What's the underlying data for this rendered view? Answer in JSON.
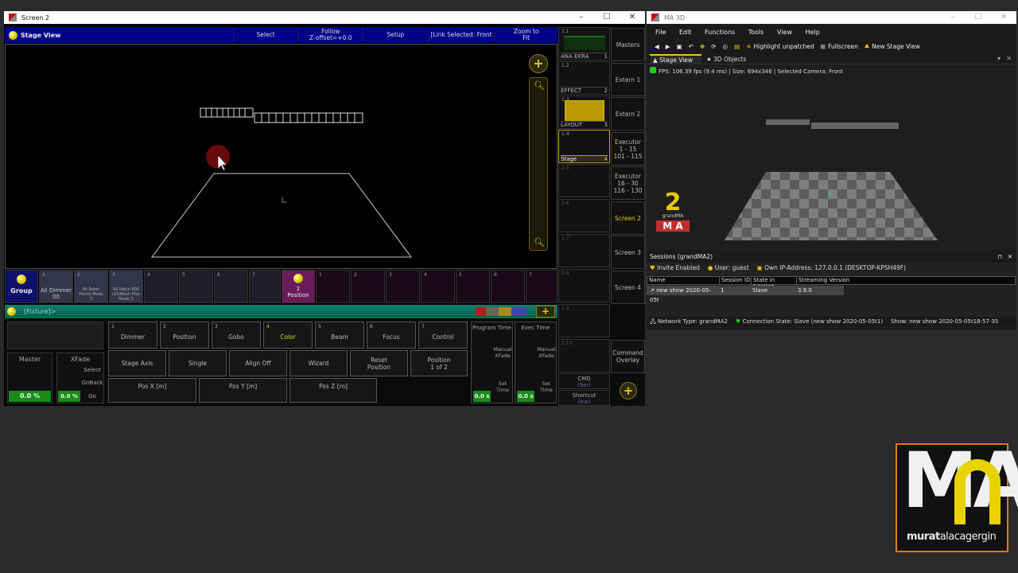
{
  "screen2": {
    "title": "Screen 2",
    "view_title": "Stage View",
    "header_buttons": [
      "Select",
      "Follow\nZ-offset=+0.0",
      "Setup",
      "[Link Selected: Front",
      "Zoom to\nFit"
    ]
  },
  "executors": [
    {
      "num": "1.1",
      "label": "ANA EKRA",
      "page": "1"
    },
    {
      "num": "1.2",
      "label": "EFFECT",
      "page": "2"
    },
    {
      "num": "1.3",
      "label": "LAYOUT",
      "page": "3"
    },
    {
      "num": "1.4",
      "label": "Stage",
      "page": "4"
    },
    {
      "num": "1.5"
    },
    {
      "num": "1.6"
    },
    {
      "num": "1.7"
    },
    {
      "num": "1.8"
    },
    {
      "num": "1.9"
    },
    {
      "num": "1.10"
    }
  ],
  "side_buttons": [
    "Masters",
    "Extern 1",
    "Extern 2",
    "Executor\n1 - 15\n101 - 115",
    "Executor\n16 - 30\n116 - 130",
    "Screen 2",
    "Screen 3",
    "Screen 4",
    "Command\nOverlay"
  ],
  "cmd": {
    "label": "CMD",
    "sub": "(Ser)"
  },
  "shortcut": {
    "label": "Shortcut",
    "sub": "(Ins)"
  },
  "group_pool": {
    "title": "Group",
    "items": [
      {
        "num": "1",
        "label": "All Dimmer\n00"
      },
      {
        "num": "2",
        "label": "All Robin\nPointe Mode\n3"
      },
      {
        "num": "3",
        "label": "All Robin 600\nLEDWash Plus\nMode 3"
      },
      {
        "num": "4"
      },
      {
        "num": "5"
      },
      {
        "num": "6"
      },
      {
        "num": "7"
      }
    ]
  },
  "preset_pool": {
    "title": "2\nPosition",
    "nums": [
      "1",
      "2",
      "3",
      "4",
      "5",
      "6",
      "7"
    ]
  },
  "command_line": "[Fixture]>",
  "preset_types": [
    {
      "num": "1",
      "label": "Dimmer"
    },
    {
      "num": "2",
      "label": "Position"
    },
    {
      "num": "3",
      "label": "Gobo"
    },
    {
      "num": "4",
      "label": "Color"
    },
    {
      "num": "5",
      "label": "Beam"
    },
    {
      "num": "6",
      "label": "Focus"
    },
    {
      "num": "7",
      "label": "Control"
    }
  ],
  "tools": [
    "Stage Axis",
    "Single",
    "Align Off",
    "Wizard",
    "Reset\nPosition",
    "Position\n1 of 2"
  ],
  "encoders": [
    "Pos X [m]",
    "Pos Y [m]",
    "Pos Z [m]"
  ],
  "master": {
    "label": "Master",
    "value": "0.0 %"
  },
  "xfade": {
    "label": "XFade",
    "value": "0.0 %",
    "select": "Select",
    "goback": "GoBack",
    "go": "Go"
  },
  "program_time": {
    "label": "Program Time",
    "manual": "Manual\nXFade",
    "set": "Set\nTime",
    "value": "0.0 s"
  },
  "exec_time": {
    "label": "Exec Time",
    "manual": "Manual\nXFade",
    "set": "Set\nTime",
    "value": "0.0 s"
  },
  "ma3d": {
    "title": "MA 3D",
    "menu": [
      "File",
      "Edit",
      "Functions",
      "Tools",
      "View",
      "Help"
    ],
    "toolbar": [
      "Highlight unpatched",
      "Fullscreen",
      "New Stage View"
    ],
    "tabs": [
      "Stage View",
      "3D Objects"
    ],
    "fps": "FPS: 106.39 fps (9.4 ms) | Size: 694x346 | Selected Camera: Front",
    "logo_num": "2",
    "logo_text": "grandMA",
    "logo_ma": "M A"
  },
  "sessions": {
    "title": "Sessions (grandMA2)",
    "invite": "Invite Enabled",
    "user": "User: guest",
    "ip": "Own IP-Address: 127.0.0.1 (DESKTOP-KPSH49F)",
    "columns": [
      "Name",
      "Session ID",
      "State in Session",
      "Streaming Version"
    ],
    "rows": [
      {
        "name": "new show 2020-05-05t",
        "id": "1",
        "state": "Slave",
        "version": "3.9.0"
      }
    ],
    "network": "Network Type: grandMA2",
    "connection": "Connection State: Slave (new show 2020-05-05t1)",
    "show": "Show: new show 2020-05-05t18-57-35"
  },
  "watermark": {
    "big": "MA",
    "name1": "murat",
    "name2": "alacagergin"
  }
}
